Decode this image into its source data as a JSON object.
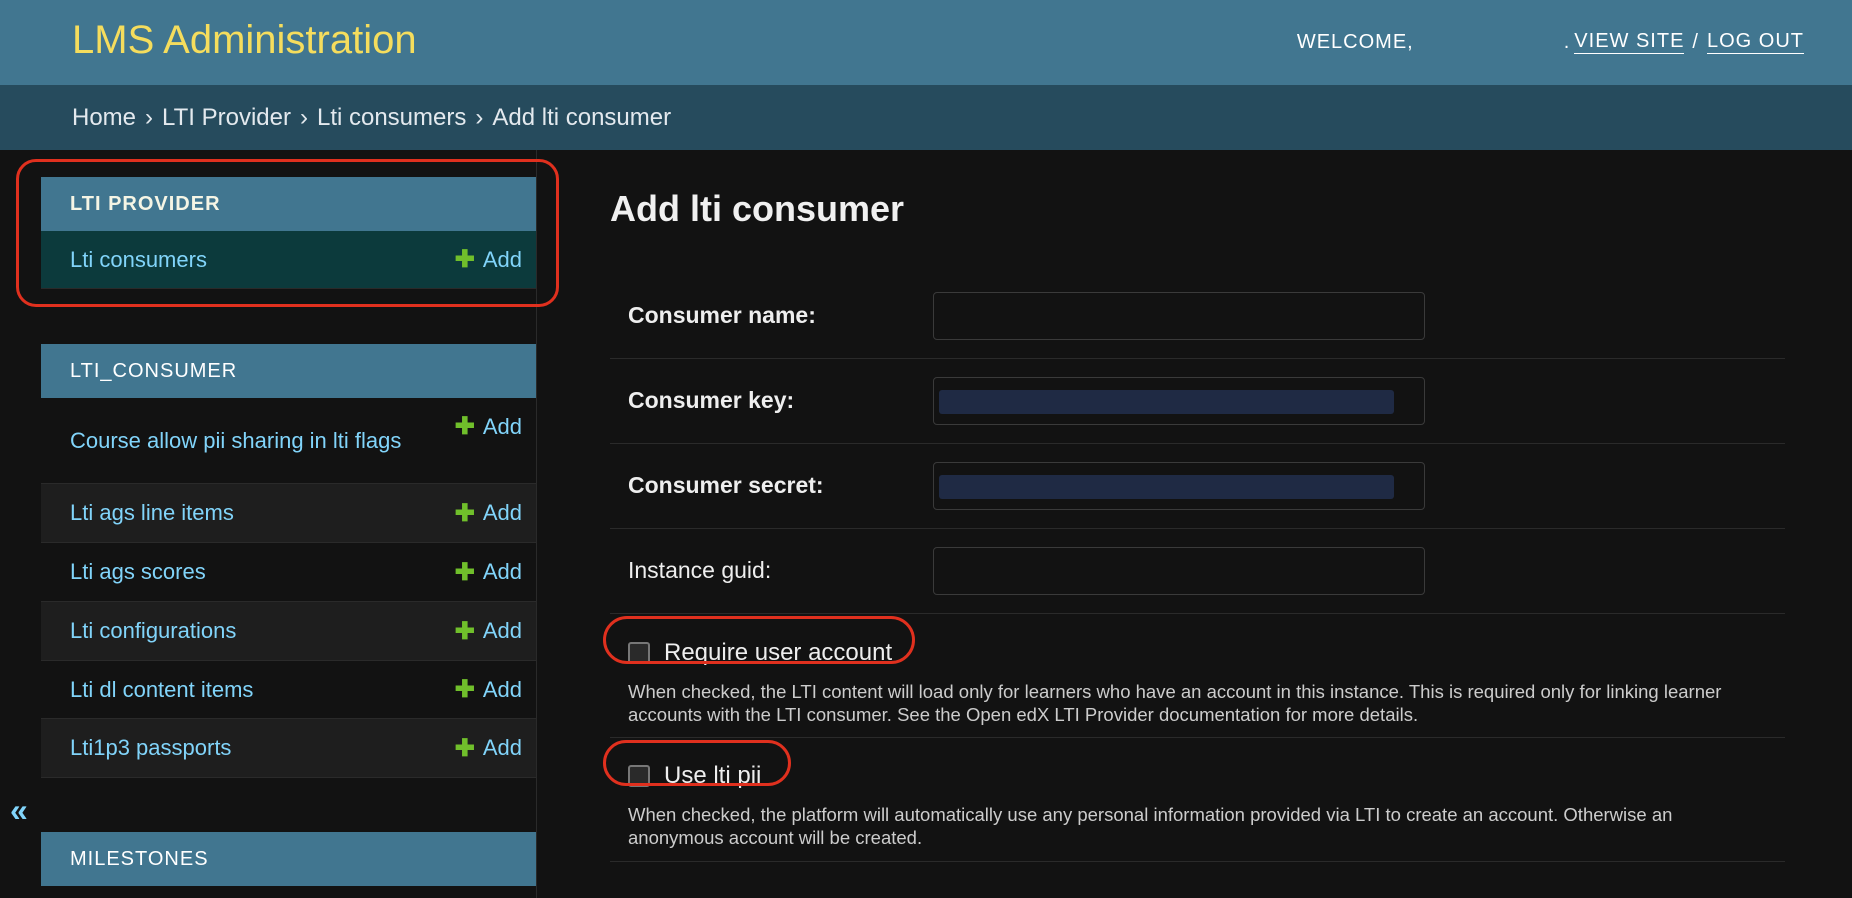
{
  "header": {
    "brand": "LMS Administration",
    "welcome": "WELCOME,",
    "view_site": "VIEW SITE",
    "separator": "/",
    "log_out": "LOG OUT"
  },
  "breadcrumbs": [
    "Home",
    "LTI Provider",
    "Lti consumers",
    "Add lti consumer"
  ],
  "breadcrumb_separator": "›",
  "sidebar": {
    "modules": [
      {
        "title": "LTI PROVIDER",
        "items": [
          {
            "label": "Lti consumers",
            "add": "Add"
          }
        ]
      },
      {
        "title": "LTI_CONSUMER",
        "items": [
          {
            "label": "Course allow pii sharing in lti flags",
            "add": "Add"
          },
          {
            "label": "Lti ags line items",
            "add": "Add"
          },
          {
            "label": "Lti ags scores",
            "add": "Add"
          },
          {
            "label": "Lti configurations",
            "add": "Add"
          },
          {
            "label": "Lti dl content items",
            "add": "Add"
          },
          {
            "label": "Lti1p3 passports",
            "add": "Add"
          }
        ]
      },
      {
        "title": "MILESTONES",
        "items": []
      }
    ],
    "collapse_glyph": "«"
  },
  "form": {
    "title": "Add lti consumer",
    "fields": {
      "consumer_name": {
        "label": "Consumer name:",
        "value": ""
      },
      "consumer_key": {
        "label": "Consumer key:",
        "value": ""
      },
      "consumer_secret": {
        "label": "Consumer secret:",
        "value": ""
      },
      "instance_guid": {
        "label": "Instance guid:",
        "value": ""
      }
    },
    "require_user_account": {
      "label": "Require user account",
      "checked": false,
      "help": "When checked, the LTI content will load only for learners who have an account in this instance. This is required only for linking learner accounts with the LTI consumer. See the Open edX LTI Provider documentation for more details."
    },
    "use_lti_pii": {
      "label": "Use lti pii",
      "checked": false,
      "help": "When checked, the platform will automatically use any personal information provided via LTI to create an account. Otherwise an anonymous account will be created."
    }
  },
  "colors": {
    "header_bg": "#417690",
    "brand": "#f5dd5d",
    "breadcrumb_bg": "#264b5d",
    "link": "#81d4fa",
    "add_plus": "#70bf2b",
    "annotation": "#e0301e"
  },
  "icons": {
    "add": "plus-icon",
    "collapse": "double-chevron-left-icon"
  }
}
